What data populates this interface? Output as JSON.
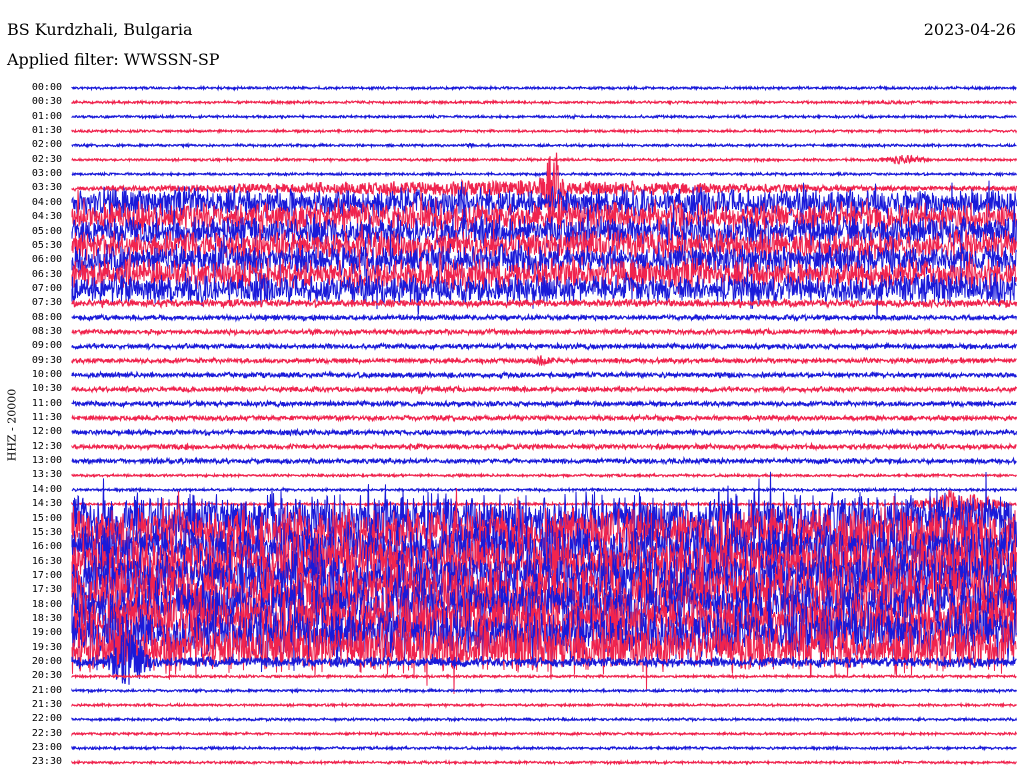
{
  "header": {
    "station": "BS Kurdzhali, Bulgaria",
    "date": "2023-04-26",
    "filter": "Applied filter: WWSSN-SP"
  },
  "chart_data": {
    "type": "line",
    "title": "BS Kurdzhali, Bulgaria",
    "subtitle": "Applied filter: WWSSN-SP",
    "ylabel": "HHZ - 20000",
    "grid": false,
    "colors": [
      "#1a1ad9",
      "#f0244e"
    ],
    "tick_labels": [
      "00:00",
      "00:30",
      "01:00",
      "01:30",
      "02:00",
      "02:30",
      "03:00",
      "03:30",
      "04:00",
      "04:30",
      "05:00",
      "05:30",
      "06:00",
      "06:30",
      "07:00",
      "07:30",
      "08:00",
      "08:30",
      "09:00",
      "09:30",
      "10:00",
      "10:30",
      "11:00",
      "11:30",
      "12:00",
      "12:30",
      "13:00",
      "13:30",
      "14:00",
      "14:30",
      "15:00",
      "15:30",
      "16:00",
      "16:30",
      "17:00",
      "17:30",
      "18:00",
      "18:30",
      "19:00",
      "19:30",
      "20:00",
      "20:30",
      "21:00",
      "21:30",
      "22:00",
      "22:30",
      "23:00",
      "23:30"
    ],
    "noise_level": [
      1,
      1,
      1,
      1,
      1,
      1,
      1,
      2,
      12,
      12,
      12,
      12,
      12,
      12,
      12,
      3,
      2,
      2,
      2,
      2,
      2,
      2,
      2,
      2,
      2,
      2,
      2,
      1,
      1,
      1,
      20,
      20,
      20,
      20,
      20,
      20,
      20,
      20,
      20,
      20,
      4,
      1,
      1,
      1,
      1,
      1,
      1,
      1
    ],
    "events": [
      {
        "trace": "00:30",
        "t": 0.87,
        "w": 0.1,
        "amp": 2
      },
      {
        "trace": "01:00",
        "t": 0.53,
        "w": 0.01,
        "amp": 3
      },
      {
        "trace": "02:00",
        "t": 0.42,
        "w": 0.01,
        "amp": 3
      },
      {
        "trace": "02:30",
        "t": 0.88,
        "w": 0.04,
        "amp": 6
      },
      {
        "trace": "03:30",
        "t": 0.45,
        "w": 0.55,
        "amp": 10
      },
      {
        "trace": "03:30",
        "t": 0.51,
        "w": 0.02,
        "amp": 45
      },
      {
        "trace": "07:00",
        "t": 0.46,
        "w": 0.03,
        "amp": 16
      },
      {
        "trace": "07:00",
        "t": 0.97,
        "w": 0.03,
        "amp": 22
      },
      {
        "trace": "09:30",
        "t": 0.5,
        "w": 0.02,
        "amp": 7
      },
      {
        "trace": "10:30",
        "t": 0.37,
        "w": 0.01,
        "amp": 7
      },
      {
        "trace": "14:30",
        "t": 0.94,
        "w": 0.06,
        "amp": 18
      },
      {
        "trace": "19:30",
        "t": 0.97,
        "w": 0.03,
        "amp": 30
      },
      {
        "trace": "20:00",
        "t": 0.06,
        "w": 0.03,
        "amp": 45
      }
    ]
  }
}
